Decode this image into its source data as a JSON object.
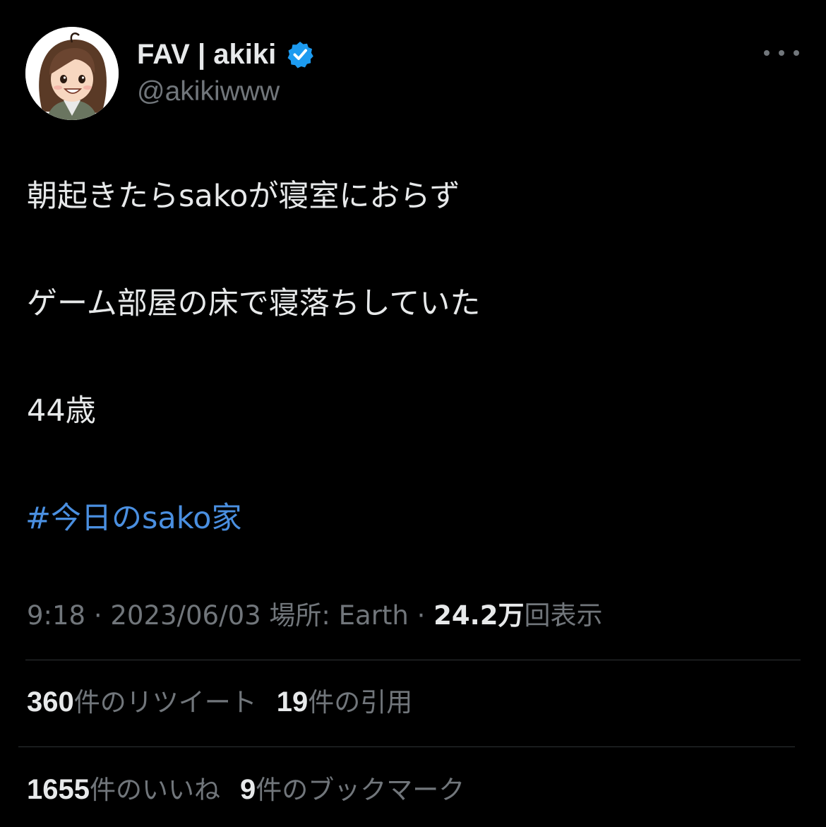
{
  "author": {
    "display_name": "FAV | akiki",
    "handle": "@akikiwww",
    "verified": true,
    "avatar_icon": "avatar-illustration-icon"
  },
  "more_icon": "more-horizontal-icon",
  "tweet": {
    "lines": [
      "朝起きたらsakoが寝室におらず",
      "ゲーム部屋の床で寝落ちしていた",
      "44歳"
    ],
    "hashtag": "#今日のsako家"
  },
  "meta": {
    "time": "9:18",
    "date": "2023/06/03",
    "location": "場所: Earth",
    "views_count": "24.2万",
    "views_label": "回表示"
  },
  "stats": {
    "retweets_count": "360",
    "retweets_label": "件のリツイート",
    "quotes_count": "19",
    "quotes_label": "件の引用",
    "likes_count": "1655",
    "likes_label": "件のいいね",
    "bookmarks_count": "9",
    "bookmarks_label": "件のブックマーク"
  },
  "colors": {
    "background": "#000000",
    "text_primary": "#e7e9ea",
    "text_secondary": "#71767b",
    "link": "#4a8fe0",
    "verified_badge": "#1d9bf0",
    "divider": "#2f3336"
  }
}
